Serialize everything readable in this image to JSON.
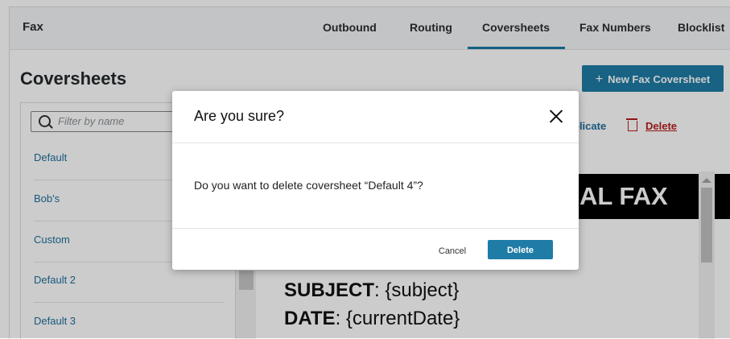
{
  "nav": {
    "app_title": "Fax",
    "tabs": [
      {
        "label": "Outbound"
      },
      {
        "label": "Routing"
      },
      {
        "label": "Coversheets"
      },
      {
        "label": "Fax Numbers"
      },
      {
        "label": "Blocklist"
      }
    ],
    "active_tab": "Coversheets"
  },
  "page": {
    "title": "Coversheets",
    "new_button_label": "New Fax Coversheet"
  },
  "sidebar": {
    "filter_placeholder": "Filter by name",
    "items": [
      {
        "label": "Default"
      },
      {
        "label": "Bob's"
      },
      {
        "label": "Custom"
      },
      {
        "label": "Default 2"
      },
      {
        "label": "Default 3"
      }
    ]
  },
  "detail": {
    "duplicate_label": "plicate",
    "delete_label": "Delete"
  },
  "preview": {
    "banner_text": "AL FAX",
    "subject_label": "SUBJECT",
    "subject_value": ": {subject}",
    "date_label": "DATE",
    "date_value": ": {currentDate}"
  },
  "modal": {
    "title": "Are you sure?",
    "body": "Do you want to delete coversheet “Default 4”?",
    "cancel_label": "Cancel",
    "delete_label": "Delete"
  },
  "colors": {
    "accent": "#1e7ca6",
    "link": "#1f6f9c",
    "danger": "#b71c1c"
  }
}
